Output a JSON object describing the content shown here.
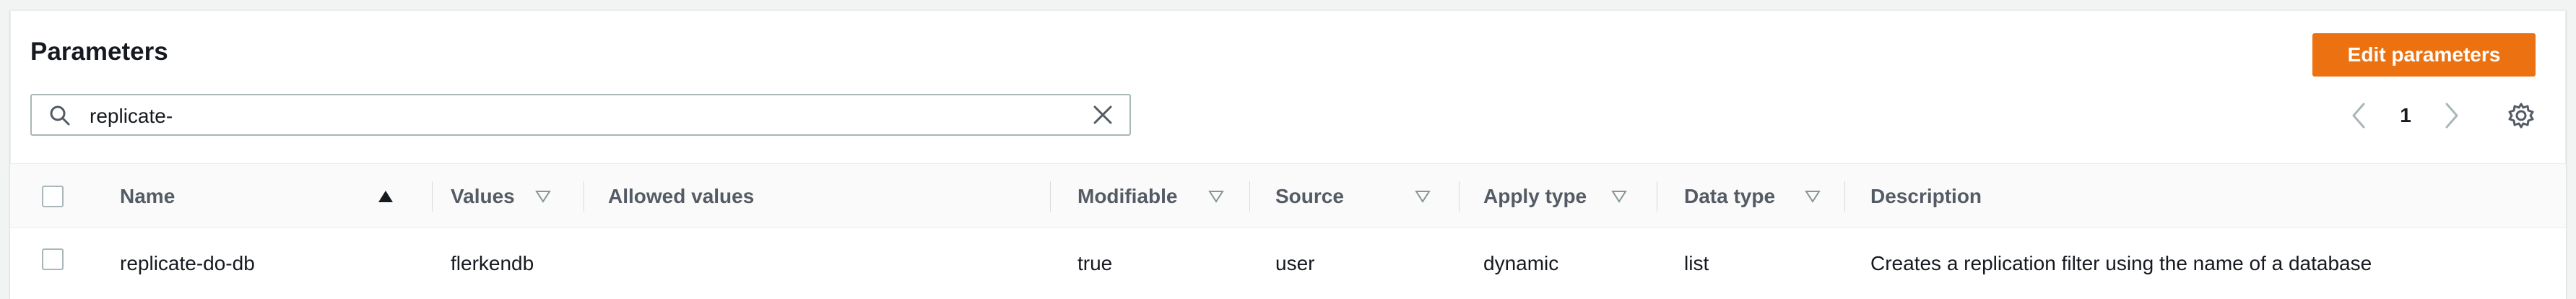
{
  "header": {
    "title": "Parameters",
    "edit_button_label": "Edit parameters"
  },
  "search": {
    "value": "replicate-"
  },
  "pagination": {
    "current_page": "1"
  },
  "table": {
    "columns": [
      {
        "label": "Name",
        "sort": "ascending"
      },
      {
        "label": "Values",
        "sort": "sortable"
      },
      {
        "label": "Allowed values",
        "sort": "none"
      },
      {
        "label": "Modifiable",
        "sort": "sortable"
      },
      {
        "label": "Source",
        "sort": "sortable"
      },
      {
        "label": "Apply type",
        "sort": "sortable"
      },
      {
        "label": "Data type",
        "sort": "sortable"
      },
      {
        "label": "Description",
        "sort": "none"
      }
    ],
    "rows": [
      {
        "name": "replicate-do-db",
        "values": "flerkendb",
        "allowed_values": "",
        "modifiable": "true",
        "source": "user",
        "apply_type": "dynamic",
        "data_type": "list",
        "description": "Creates a replication filter using the name of a database"
      }
    ]
  },
  "colors": {
    "accent": "#ec7211",
    "header_text": "#545b64",
    "border": "#aab7b8"
  }
}
